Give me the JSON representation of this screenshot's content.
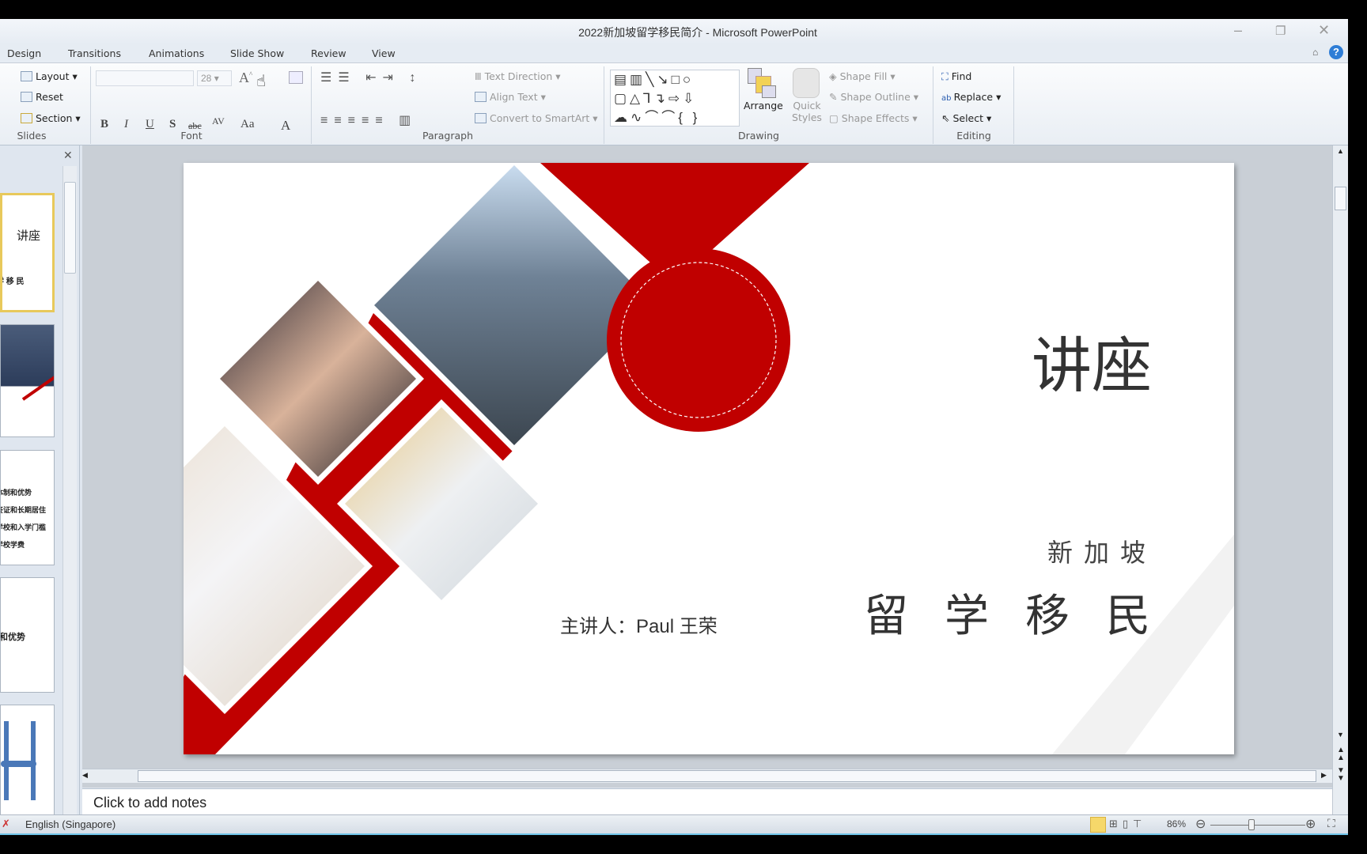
{
  "window": {
    "title": "2022新加坡留学移民简介 - Microsoft PowerPoint",
    "minimize": "–",
    "restore": "❐",
    "close": "✕"
  },
  "tabs": [
    "Design",
    "Transitions",
    "Animations",
    "Slide Show",
    "Review",
    "View"
  ],
  "ribbon": {
    "slides": {
      "layout": "Layout ▾",
      "reset": "Reset",
      "section": "Section ▾",
      "label": "Slides"
    },
    "font": {
      "name": "",
      "size": "28",
      "buttons": [
        "B",
        "I",
        "U",
        "S",
        "abc",
        "AV",
        "Aa",
        "A"
      ],
      "label": "Font"
    },
    "paragraph": {
      "text_direction": "Text Direction ▾",
      "align_text": "Align Text ▾",
      "convert_smartart": "Convert to SmartArt ▾",
      "label": "Paragraph"
    },
    "drawing": {
      "arrange": "Arrange",
      "quick_styles": "Quick Styles",
      "shape_fill": "Shape Fill ▾",
      "shape_outline": "Shape Outline ▾",
      "shape_effects": "Shape Effects ▾",
      "label": "Drawing"
    },
    "editing": {
      "find": "Find",
      "replace": "Replace ▾",
      "select": "Select ▾",
      "label": "Editing"
    },
    "help": "?"
  },
  "thumbnails": [
    {
      "title": "讲座",
      "sub": "学 移 民"
    },
    {
      "title": ""
    },
    {
      "lines": [
        "体制和优势",
        "签证和长期居住",
        "学校和入学门槛",
        "学校学费"
      ]
    },
    {
      "title": "和优势"
    },
    {
      "title": ""
    }
  ],
  "slide": {
    "title": "讲座",
    "subtitle_small": "新加坡",
    "subtitle_large": "留学移民",
    "speaker": "主讲人：Paul 王荣",
    "accent": "#c00000"
  },
  "notes": {
    "placeholder": "Click to add notes"
  },
  "status": {
    "language": "English (Singapore)",
    "zoom": "86%",
    "zoom_percent": 86
  }
}
